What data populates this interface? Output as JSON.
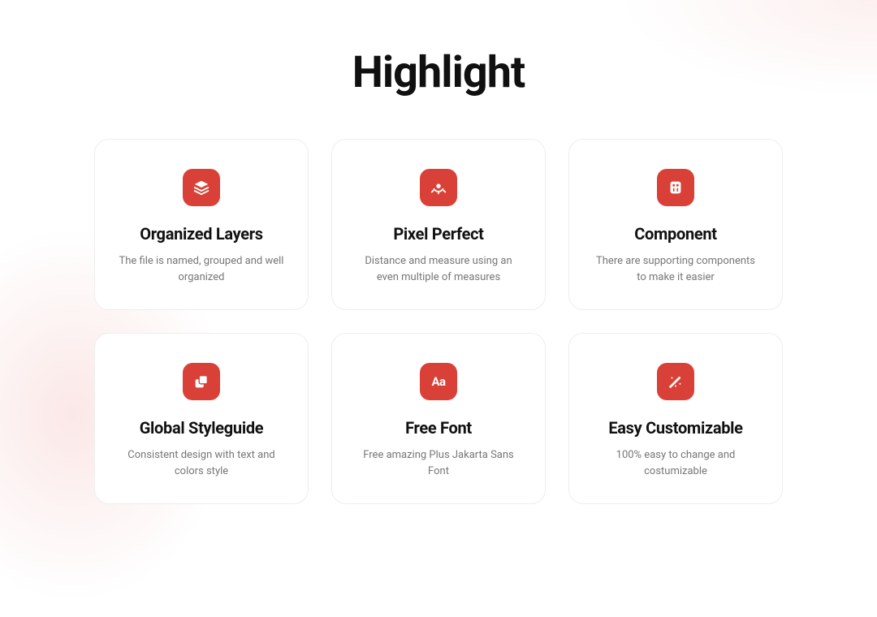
{
  "title": "Highlight",
  "accent_color": "#D94138",
  "cards": [
    {
      "icon": "layers-icon",
      "title": "Organized Layers",
      "desc": "The file is named, grouped and well organized"
    },
    {
      "icon": "pixel-icon",
      "title": "Pixel Perfect",
      "desc": "Distance and measure using an even multiple of measures"
    },
    {
      "icon": "component-icon",
      "title": "Component",
      "desc": "There are supporting components to make it easier"
    },
    {
      "icon": "styleguide-icon",
      "title": "Global Styleguide",
      "desc": "Consistent design with text and colors style"
    },
    {
      "icon": "font-icon",
      "title": "Free Font",
      "desc": "Free amazing Plus Jakarta Sans  Font"
    },
    {
      "icon": "customize-icon",
      "title": "Easy Customizable",
      "desc": "100% easy to change and costumizable"
    }
  ]
}
